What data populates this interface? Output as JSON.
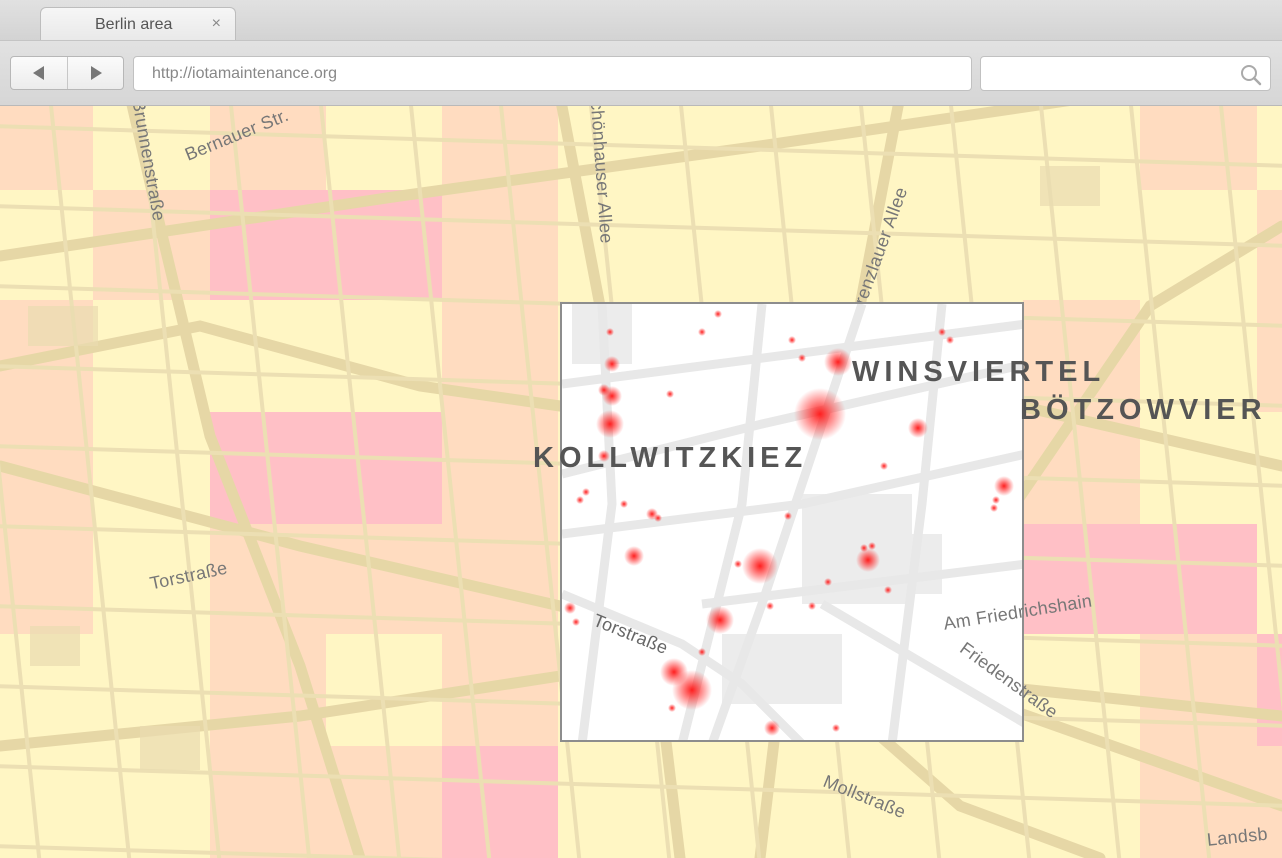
{
  "browser": {
    "tab_title": "Berlin area",
    "tab_close": "×",
    "url": "http://iotamaintenance.org",
    "search_placeholder": ""
  },
  "map": {
    "street_labels": [
      "Bernauer Str.",
      "Brunnenstraße",
      "Schönhauser Allee",
      "Prenzlauer Allee",
      "Torstraße",
      "Torstraße",
      "Am Friedrichshain",
      "Friedenstraße",
      "Mollstraße",
      "Landsb"
    ],
    "district_labels": [
      "KOLLWITZKIEZ",
      "WINSVIERTEL",
      "BÖTZOWVIER"
    ],
    "grid_colors": {
      "light": "#fff6c4",
      "medium": "#ffdcc0",
      "high": "#ffc0c6"
    },
    "heat_color": "#ff1f1f"
  }
}
